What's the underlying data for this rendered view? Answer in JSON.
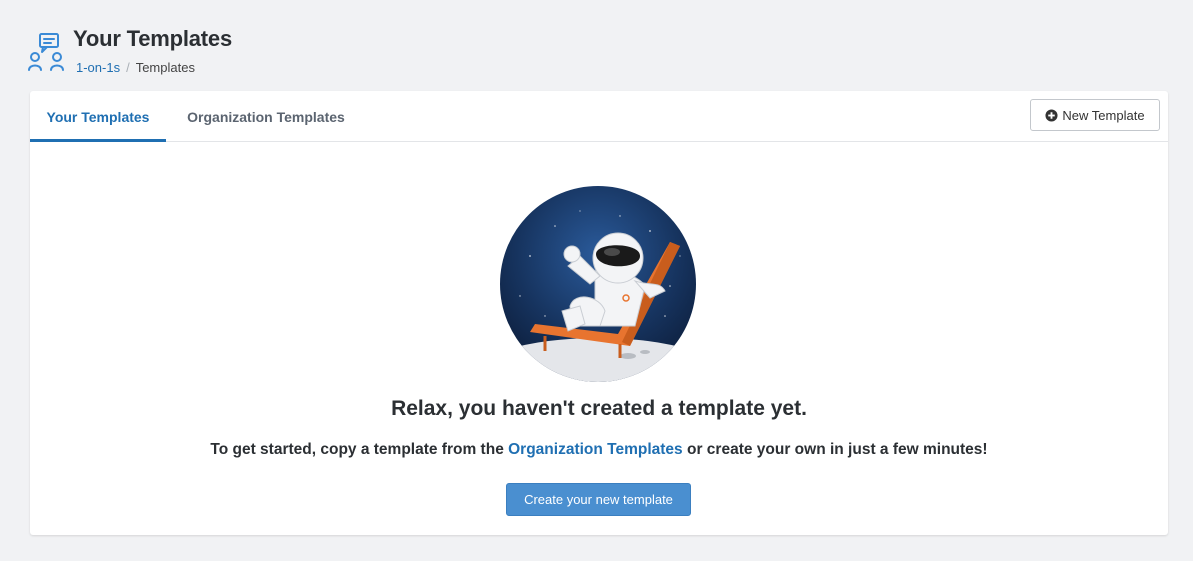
{
  "header": {
    "title": "Your Templates",
    "icon": "one-on-one-icon",
    "breadcrumb": {
      "link": "1-on-1s",
      "separator": "/",
      "current": "Templates"
    }
  },
  "tabs": [
    {
      "label": "Your Templates",
      "active": true
    },
    {
      "label": "Organization Templates",
      "active": false
    }
  ],
  "toolbar": {
    "new_template_label": "New Template",
    "new_template_icon": "plus-circle-icon"
  },
  "empty_state": {
    "illustration": "astronaut-relaxing-icon",
    "title": "Relax, you haven't created a template yet.",
    "text_before": "To get started, copy a template from the",
    "link_text": "Organization Templates",
    "text_after": "or create your own in just a few minutes!",
    "button_label": "Create your new template"
  },
  "colors": {
    "accent": "#1f6fb2",
    "button": "#4a8fd0",
    "background": "#f1f2f4"
  }
}
